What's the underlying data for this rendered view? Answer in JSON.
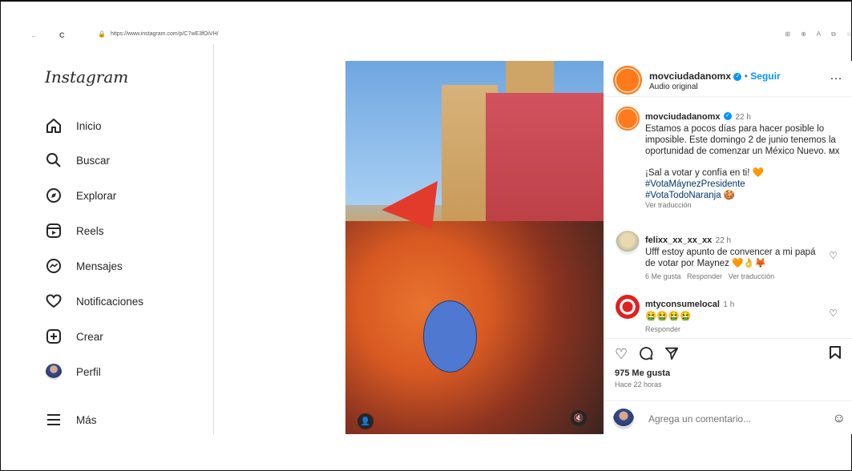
{
  "browser": {
    "url": "https://www.instagram.com/p/C7wE3fOiVH/",
    "nav_back": "←",
    "nav_refresh": "C",
    "toolbar_icons": [
      "grid-icon",
      "zoom-icon",
      "read-aloud-icon",
      "extension-icon",
      "favorite-icon"
    ]
  },
  "sidebar": {
    "logo": "Instagram",
    "items": [
      {
        "label": "Inicio",
        "icon": "home-icon"
      },
      {
        "label": "Buscar",
        "icon": "search-icon"
      },
      {
        "label": "Explorar",
        "icon": "compass-icon"
      },
      {
        "label": "Reels",
        "icon": "reels-icon"
      },
      {
        "label": "Mensajes",
        "icon": "messenger-icon"
      },
      {
        "label": "Notificaciones",
        "icon": "heart-icon"
      },
      {
        "label": "Crear",
        "icon": "plus-square-icon"
      },
      {
        "label": "Perfil",
        "icon": "avatar"
      },
      {
        "label": "Más",
        "icon": "menu-icon"
      }
    ]
  },
  "post": {
    "header": {
      "username": "movciudadanomx",
      "separator": "•",
      "follow": "Seguir",
      "subtitle": "Audio original",
      "more": "…"
    },
    "caption": {
      "username": "movciudadanomx",
      "time": "22 h",
      "text": "Estamos a pocos días para hacer posible lo imposible. Este domingo 2 de junio tenemos la oportunidad de comenzar un México Nuevo. ᴍx",
      "line2": "¡Sal a votar y confía en ti! 🧡",
      "tag1": "#VotaMáynezPresidente",
      "tag2": "#VotaTodoNaranja 🍪",
      "translate": "Ver traducción"
    },
    "comments": [
      {
        "username": "felixx_xx_xx_xx",
        "time": "22 h",
        "text": "Ufff estoy apunto de convencer a mi papá de votar por Maynez 🧡👌🦊",
        "likes": "6 Me gusta",
        "reply": "Responder",
        "translate": "Ver traducción"
      },
      {
        "username": "mtyconsumelocal",
        "time": "1 h",
        "text": "🤮🤮🤮🤮",
        "reply": "Responder"
      }
    ],
    "likes": "975 Me gusta",
    "posted": "Hace 22 horas",
    "comment_placeholder": "Agrega un comentario...",
    "emoji_icon": "☺"
  },
  "colors": {
    "brand_orange": "#ff7a1a",
    "link_blue": "#0095f6",
    "text": "#262626",
    "muted": "#737373"
  }
}
